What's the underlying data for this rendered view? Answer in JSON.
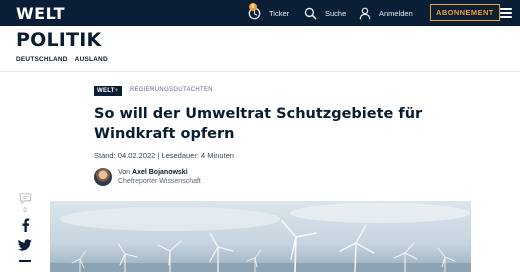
{
  "header": {
    "logo": "WELT",
    "ticker_badge": "8",
    "ticker_label": "Ticker",
    "search_label": "Suche",
    "login_label": "Anmelden",
    "subscribe_label": "ABONNEMENT"
  },
  "section": {
    "title": "POLITIK",
    "subnav": [
      "DEUTSCHLAND",
      "AUSLAND"
    ]
  },
  "article": {
    "plus_badge_text": "WELT",
    "plus_badge_plus": "+",
    "kicker": "REGIERUNGSGUTACHTEN",
    "headline": "So will der Umweltrat Schutzgebiete für Windkraft opfern",
    "meta": "Stand: 04.02.2022 | Lesedauer: 4 Minuten",
    "author_prefix": "Von ",
    "author_name": "Axel Bojanowski",
    "author_role": "Chefreporter Wissenschaft"
  },
  "social": {
    "comment_count": "0"
  },
  "colors": {
    "navy": "#0a1e35",
    "accent": "#f0a030"
  },
  "icons": [
    "clock-icon",
    "search-icon",
    "user-icon",
    "menu-icon",
    "comment-icon",
    "facebook-icon",
    "twitter-icon",
    "more-icon"
  ]
}
